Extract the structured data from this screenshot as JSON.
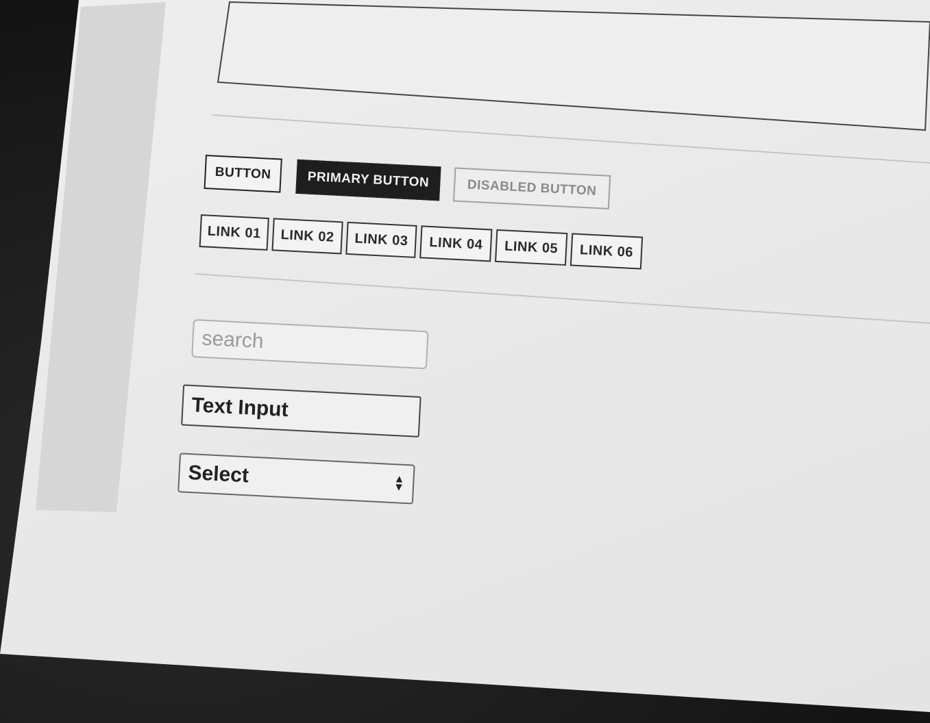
{
  "buttons": {
    "default_label": "BUTTON",
    "primary_label": "PRIMARY BUTTON",
    "disabled_label": "DISABLED BUTTON"
  },
  "links": [
    {
      "label": "LINK 01"
    },
    {
      "label": "LINK 02"
    },
    {
      "label": "LINK 03"
    },
    {
      "label": "LINK 04"
    },
    {
      "label": "LINK 05"
    },
    {
      "label": "LINK 06"
    }
  ],
  "form": {
    "search_placeholder": "search",
    "text_input_value": "Text Input",
    "select_value": "Select"
  },
  "icons": {
    "select_arrows": "up-down-arrows-icon"
  },
  "colors": {
    "primary_button_bg": "#1e1e1e",
    "page_bg": "#ebebeb",
    "sidebar_bg": "#d6d6d6"
  }
}
